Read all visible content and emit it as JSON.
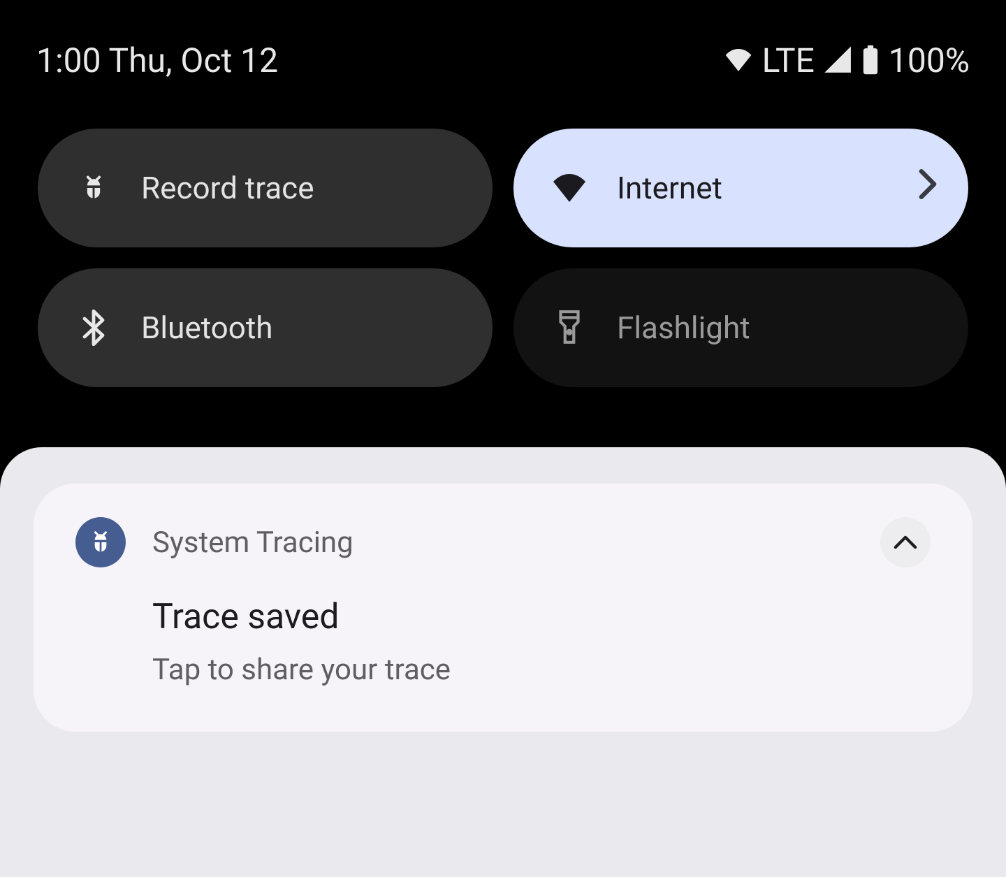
{
  "status": {
    "time_date": "1:00 Thu, Oct 12",
    "network_label": "LTE",
    "battery_pct": "100%"
  },
  "quick_settings": {
    "tiles": [
      {
        "icon": "bug-icon",
        "label": "Record trace",
        "state": "off-dark",
        "chevron": false
      },
      {
        "icon": "wifi-icon",
        "label": "Internet",
        "state": "on",
        "chevron": true
      },
      {
        "icon": "bluetooth-icon",
        "label": "Bluetooth",
        "state": "off-dark",
        "chevron": false
      },
      {
        "icon": "flashlight-icon",
        "label": "Flashlight",
        "state": "off-darker",
        "chevron": false
      }
    ]
  },
  "notification": {
    "app_name": "System Tracing",
    "title": "Trace saved",
    "text": "Tap to share your trace"
  }
}
